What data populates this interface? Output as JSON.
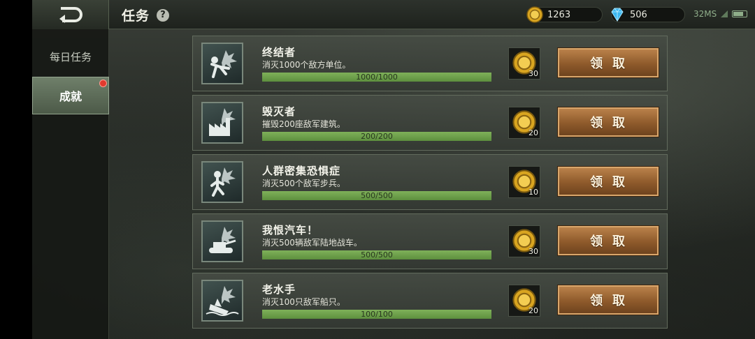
{
  "header": {
    "title": "任务",
    "help_label": "?",
    "gold": "1263",
    "gems": "506",
    "ping": "32MS"
  },
  "sidebar": {
    "items": [
      {
        "label": "每日任务"
      },
      {
        "label": "成就"
      }
    ]
  },
  "tasks": [
    {
      "name": "终结者",
      "desc": "消灭1000个敌方单位。",
      "progress": "1000/1000",
      "fraction": 1.0,
      "reward": "30",
      "button": "领取"
    },
    {
      "name": "毁灭者",
      "desc": "摧毁200座敌军建筑。",
      "progress": "200/200",
      "fraction": 1.0,
      "reward": "20",
      "button": "领取"
    },
    {
      "name": "人群密集恐惧症",
      "desc": "消灭500个敌军步兵。",
      "progress": "500/500",
      "fraction": 1.0,
      "reward": "10",
      "button": "领取"
    },
    {
      "name": "我恨汽车！",
      "desc": "消灭500辆敌军陆地战车。",
      "progress": "500/500",
      "fraction": 1.0,
      "reward": "30",
      "button": "领取"
    },
    {
      "name": "老水手",
      "desc": "消灭100只敌军船只。",
      "progress": "100/100",
      "fraction": 1.0,
      "reward": "20",
      "button": "领取"
    }
  ],
  "icons": {
    "back": "back-arrow-icon",
    "gold": "gold-coin-icon",
    "gem": "diamond-icon",
    "wifi": "wifi-icon",
    "battery": "battery-icon"
  },
  "colors": {
    "progress": "#7fb159",
    "claim": "#a06a36",
    "badge": "#e23a2e"
  }
}
